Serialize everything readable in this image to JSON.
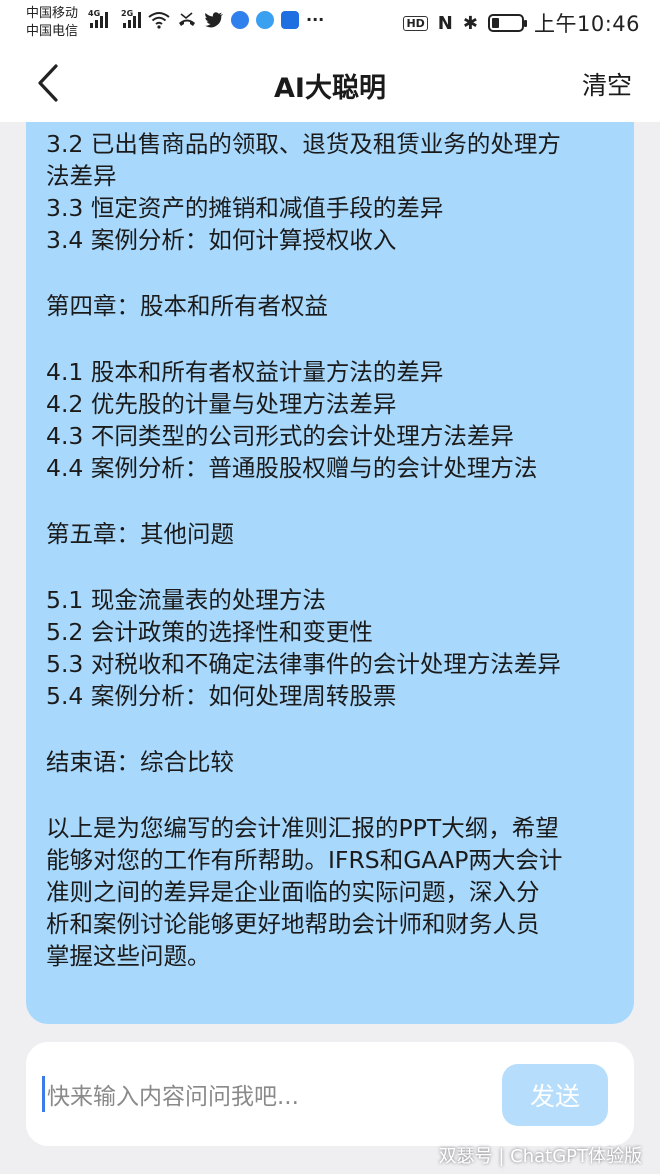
{
  "status_bar": {
    "carrier_1": "中国移动",
    "carrier_2": "中国电信",
    "net_1": "4G",
    "net_2": "2G",
    "hd": "HD",
    "nfc": "N",
    "bluetooth": "✱",
    "more": "···",
    "time": "上午10:46"
  },
  "header": {
    "title": "AI大聪明",
    "clear_label": "清空"
  },
  "message": {
    "lines_top": [
      "3.2 已出售商品的领取、退货及租赁业务的处理方",
      "法差异",
      "3.3 恒定资产的摊销和减值手段的差异",
      "3.4 案例分析：如何计算授权收入"
    ],
    "chapter4": "第四章：股本和所有者权益",
    "lines_ch4": [
      "4.1 股本和所有者权益计量方法的差异",
      "4.2 优先股的计量与处理方法差异",
      "4.3 不同类型的公司形式的会计处理方法差异",
      "4.4 案例分析：普通股股权赠与的会计处理方法"
    ],
    "chapter5": "第五章：其他问题",
    "lines_ch5": [
      "5.1 现金流量表的处理方法",
      "5.2 会计政策的选择性和变更性",
      "5.3 对税收和不确定法律事件的会计处理方法差异",
      "5.4 案例分析：如何处理周转股票"
    ],
    "conclusion": "结束语：综合比较",
    "closing_lines": [
      "以上是为您编写的会计准则汇报的PPT大纲，希望",
      "能够对您的工作有所帮助。IFRS和GAAP两大会计",
      "准则之间的差异是企业面临的实际问题，深入分",
      "析和案例讨论能够更好地帮助会计师和财务人员",
      "掌握这些问题。"
    ]
  },
  "input": {
    "placeholder": "快来输入内容问问我吧...",
    "send_label": "发送"
  },
  "watermark": "双瑟号 | ChatGPT体验版",
  "colors": {
    "bubble": "#a8d8fc",
    "send_button": "#b6defc",
    "caret": "#3d7be8",
    "background": "#efeff2"
  }
}
